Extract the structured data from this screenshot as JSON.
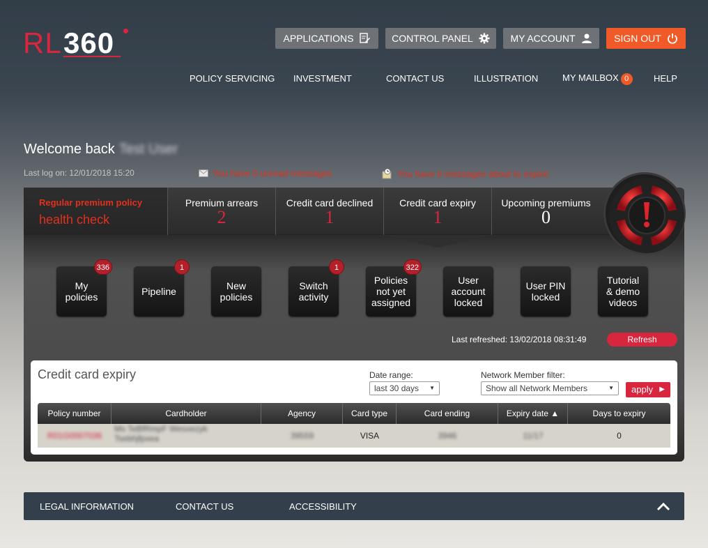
{
  "logo": {
    "rl": "RL",
    "num": "360"
  },
  "top_buttons": {
    "applications": "APPLICATIONS",
    "control_panel": "CONTROL PANEL",
    "my_account": "MY ACCOUNT",
    "sign_out": "SIGN OUT"
  },
  "nav": {
    "policy_servicing": "POLICY SERVICING",
    "investment": "INVESTMENT",
    "contact_us": "CONTACT US",
    "illustration": "ILLUSTRATION",
    "my_mailbox": "MY MAILBOX",
    "mailbox_count": "0",
    "help": "HELP"
  },
  "welcome": {
    "text": "Welcome back",
    "user": "Test User"
  },
  "last_logon": "Last log on: 12/01/2018 15:20",
  "messages": {
    "unread": "You have 0 unread messages",
    "expire": "You have 0 messages about to expire"
  },
  "tabs": {
    "health_line1": "Regular premium policy",
    "health_line2": "health check",
    "premium_arrears": {
      "label": "Premium arrears",
      "value": "2"
    },
    "credit_card_declined": {
      "label": "Credit card declined",
      "value": "1"
    },
    "credit_card_expiry": {
      "label": "Credit card expiry",
      "value": "1"
    },
    "upcoming_premiums": {
      "label": "Upcoming premiums",
      "value": "0"
    }
  },
  "tiles": {
    "my_policies": {
      "label": "My policies",
      "badge": "336"
    },
    "pipeline": {
      "label": "Pipeline",
      "badge": "1"
    },
    "new_policies": {
      "label": "New policies"
    },
    "switch_activity": {
      "label": "Switch activity",
      "badge": "1"
    },
    "policies_not_assigned": {
      "label": "Policies not yet assigned",
      "badge": "322"
    },
    "user_account_locked": {
      "label": "User account locked"
    },
    "user_pin_locked": {
      "label": "User PIN locked"
    },
    "tutorial": {
      "label": "Tutorial & demo videos"
    }
  },
  "last_refreshed": "Last refreshed: 13/02/2018 08:31:49",
  "refresh_label": "Refresh",
  "card": {
    "title": "Credit card expiry",
    "date_range_label": "Date range:",
    "date_range_value": "last 30 days",
    "network_label": "Network Member filter:",
    "network_value": "Show all Network Members",
    "apply_label": "apply"
  },
  "table": {
    "headers": [
      "Policy number",
      "Cardholder",
      "Agency",
      "Card type",
      "Card ending",
      "Expiry date ▲",
      "Days to expiry"
    ],
    "row": {
      "policy_number": "R01G0007036",
      "cardholder_line1": "Ms TeBfRmpF Wesxezyk",
      "cardholder_line2": "Tsebhjfpxea",
      "agency": "39559",
      "card_type": "VISA",
      "card_ending": "3946",
      "expiry_date": "11/17",
      "days_to_expiry": "0"
    }
  },
  "footer": {
    "legal": "LEGAL INFORMATION",
    "contact": "CONTACT US",
    "accessibility": "ACCESSIBILITY"
  },
  "colors": {
    "brand_red": "#d7263d",
    "orange": "#f05a28",
    "nav_bg": "#333f4b"
  }
}
